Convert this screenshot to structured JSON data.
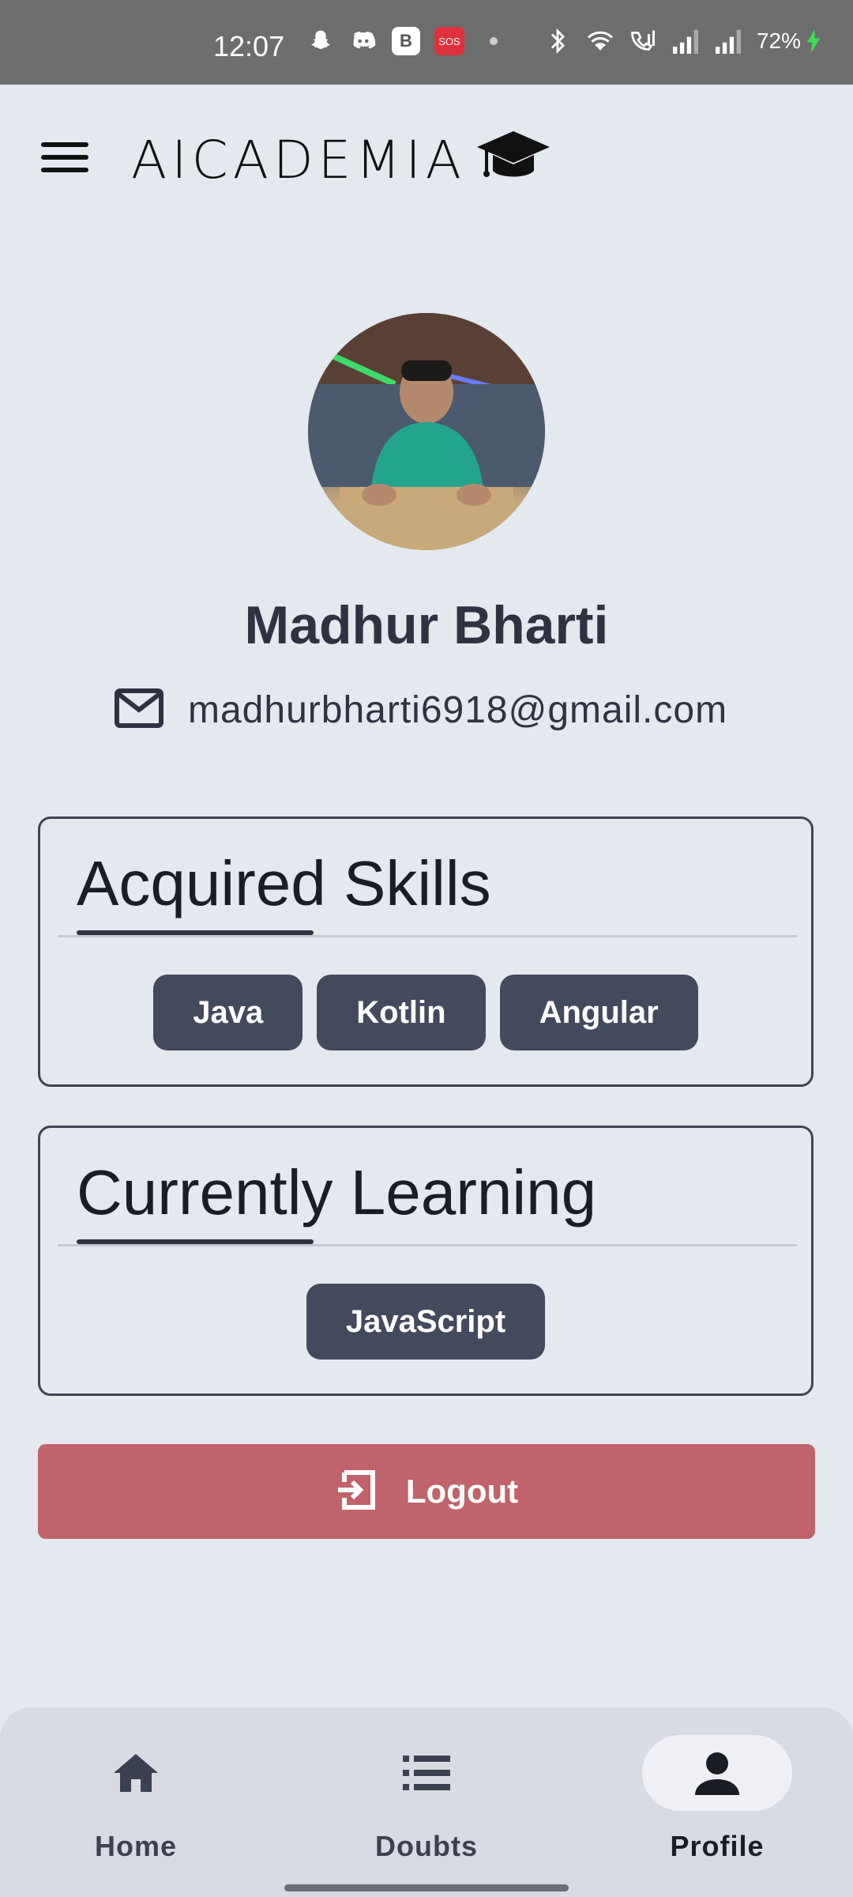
{
  "status_bar": {
    "time": "12:07",
    "battery": "72%",
    "icons": [
      "snapchat-icon",
      "discord-icon",
      "b-app-icon",
      "sos-icon",
      "dot-icon",
      "bluetooth-icon",
      "wifi-icon",
      "wifi-calling-icon",
      "signal-icon",
      "signal-icon",
      "battery-charging-icon"
    ],
    "b_label": "B",
    "sos_label": "SOS"
  },
  "header": {
    "app_name": "AICADEMIA",
    "logo_icon": "graduation-cap-icon",
    "menu_icon": "hamburger-menu-icon"
  },
  "profile": {
    "name": "Madhur Bharti",
    "email": "madhurbharti6918@gmail.com",
    "email_icon": "mail-icon"
  },
  "acquired_skills": {
    "title": "Acquired Skills",
    "chips": [
      "Java",
      "Kotlin",
      "Angular"
    ]
  },
  "currently_learning": {
    "title": "Currently Learning",
    "chips": [
      "JavaScript"
    ]
  },
  "logout": {
    "label": "Logout",
    "icon": "logout-icon"
  },
  "bottom_nav": {
    "items": [
      {
        "label": "Home",
        "icon": "home-icon",
        "active": false
      },
      {
        "label": "Doubts",
        "icon": "list-icon",
        "active": false
      },
      {
        "label": "Profile",
        "icon": "person-icon",
        "active": true
      }
    ]
  },
  "colors": {
    "background": "#e4e8ef",
    "chip": "#434a5d",
    "logout": "#c0636b",
    "nav_bar": "#d8dbe3"
  }
}
